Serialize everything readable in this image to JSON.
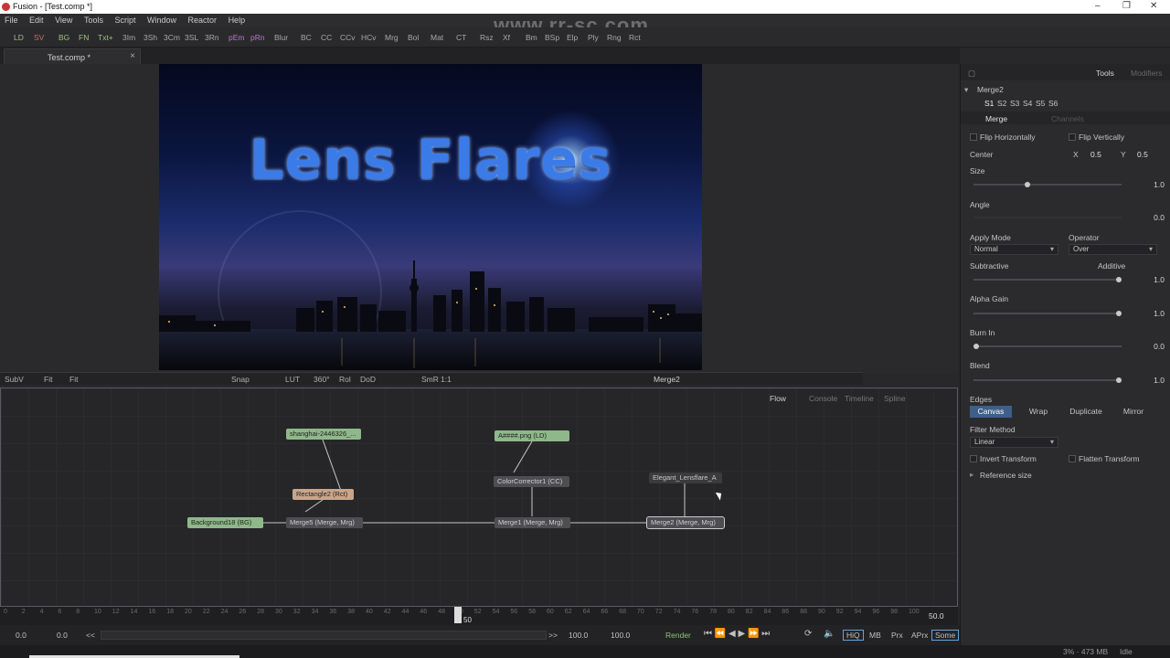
{
  "window": {
    "title": "Fusion - [Test.comp *]",
    "controls": [
      "–",
      "❐",
      "✕"
    ]
  },
  "watermark": "www.rr-sc.com",
  "menu": [
    "File",
    "Edit",
    "View",
    "Tools",
    "Script",
    "Window",
    "Reactor",
    "Help"
  ],
  "toolbar": [
    "LD",
    "SV",
    "BG",
    "FN",
    "Txt+",
    "3Im",
    "3Sh",
    "3Cm",
    "3SL",
    "3Rn",
    "pEm",
    "pRn",
    "Blur",
    "BC",
    "CC",
    "CCv",
    "HCv",
    "Mrg",
    "Bol",
    "Mat",
    "CT",
    "Rsz",
    "Xf",
    "Bm",
    "BSp",
    "Elp",
    "Ply",
    "Rng",
    "Rct"
  ],
  "comp_tab": {
    "label": "Test.comp *",
    "close": "×"
  },
  "viewer": {
    "title_text": "Lens Flares"
  },
  "viewer_bar": {
    "subv": "SubV",
    "fit1": "Fit",
    "fit2": "Fit",
    "snap": "Snap",
    "lut": "LUT",
    "deg": "360°",
    "rol": "Rol",
    "dod": "DoD",
    "smr": "SmR",
    "ratio": "1:1",
    "node": "Merge2"
  },
  "flow_tabs": {
    "flow": "Flow",
    "console": "Console",
    "timeline": "Timeline",
    "spline": "Spline"
  },
  "nodes": {
    "shanghai": "shanghai-2446326_...",
    "rectangle": "Rectangle2 (Rct)",
    "background": "Background18 (BG)",
    "merge5": "Merge5 (Merge, Mrg)",
    "loader": "A####.png (LD)",
    "cc": "ColorCorrector1 (CC)",
    "merge1": "Merge1 (Merge, Mrg)",
    "lensflare": "Elegant_Lensflare_A",
    "merge2": "Merge2 (Merge, Mrg)"
  },
  "timeline": {
    "ticks": [
      "0",
      "2",
      "4",
      "6",
      "8",
      "10",
      "12",
      "14",
      "16",
      "18",
      "20",
      "22",
      "24",
      "26",
      "28",
      "30",
      "32",
      "34",
      "36",
      "38",
      "40",
      "42",
      "44",
      "46",
      "48",
      "50",
      "52",
      "54",
      "56",
      "58",
      "60",
      "62",
      "64",
      "66",
      "68",
      "70",
      "72",
      "74",
      "76",
      "78",
      "80",
      "82",
      "84",
      "86",
      "88",
      "90",
      "92",
      "94",
      "96",
      "98",
      "100"
    ],
    "current": "50",
    "end": "50.0"
  },
  "transport": {
    "start": "0.0",
    "render_start": "0.0",
    "back": "<<",
    "fwd": ">>",
    "render_end": "100.0",
    "end": "100.0",
    "render": "Render",
    "hiq": "HiQ",
    "mb": "MB",
    "prx": "Prx",
    "aprx": "APrx",
    "some": "Some"
  },
  "status": {
    "mem": "3% · 473 MB",
    "state": "Idle"
  },
  "inspector": {
    "tabs": {
      "tools": "Tools",
      "modifiers": "Modifiers"
    },
    "tool": "Merge2",
    "slots": [
      "S1",
      "S2",
      "S3",
      "S4",
      "S5",
      "S6"
    ],
    "subtabs": {
      "merge": "Merge",
      "channels": "Channels"
    },
    "flip_h": "Flip Horizontally",
    "flip_v": "Flip Vertically",
    "center": {
      "label": "Center",
      "x_label": "X",
      "x": "0.5",
      "y_label": "Y",
      "y": "0.5"
    },
    "size": {
      "label": "Size",
      "value": "1.0",
      "level": 0.36
    },
    "angle": {
      "label": "Angle",
      "value": "0.0"
    },
    "apply_mode": {
      "label": "Apply Mode",
      "value": "Normal"
    },
    "operator": {
      "label": "Operator",
      "value": "Over"
    },
    "subtractive": "Subtractive",
    "additive": "Additive",
    "sub_add": {
      "value": "1.0",
      "level": 1.0
    },
    "alpha_gain": {
      "label": "Alpha Gain",
      "value": "1.0",
      "level": 1.0
    },
    "burn_in": {
      "label": "Burn In",
      "value": "0.0",
      "level": 0.0
    },
    "blend": {
      "label": "Blend",
      "value": "1.0",
      "level": 1.0
    },
    "edges": {
      "label": "Edges",
      "options": [
        "Canvas",
        "Wrap",
        "Duplicate",
        "Mirror"
      ]
    },
    "filter": {
      "label": "Filter Method",
      "value": "Linear"
    },
    "invert": "Invert Transform",
    "flatten": "Flatten Transform",
    "reference": "Reference size"
  }
}
